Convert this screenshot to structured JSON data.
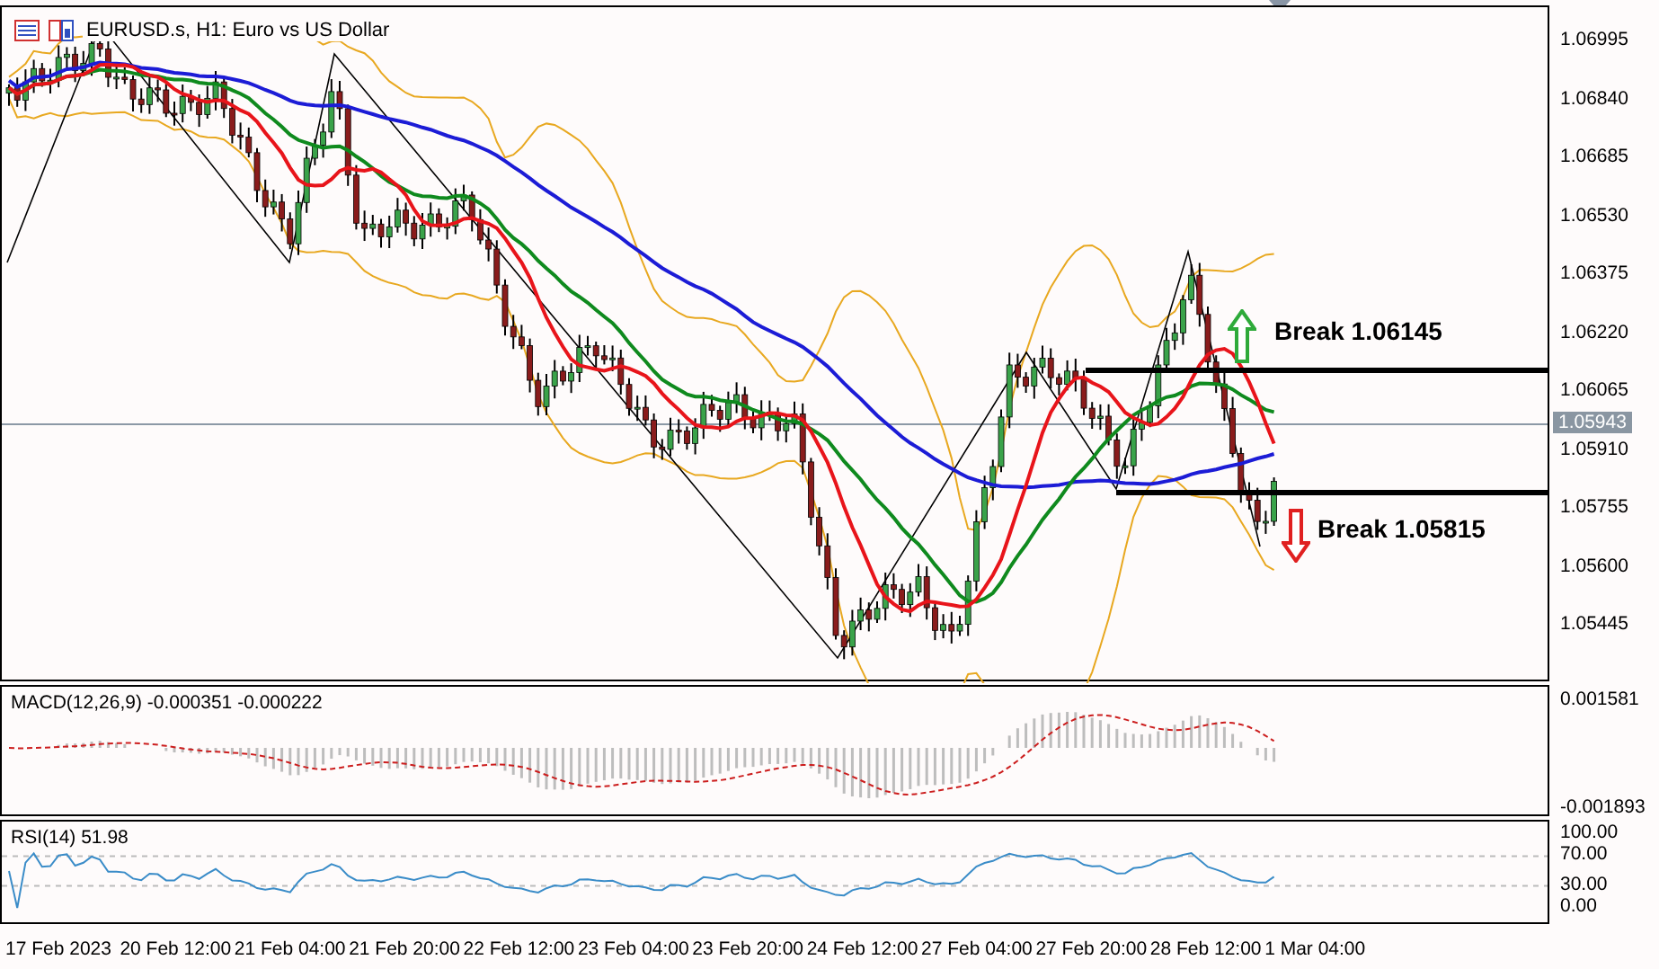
{
  "chart": {
    "title": "EURUSD.s, H1:  Euro vs US Dollar",
    "price_ticks": [
      "1.06995",
      "1.06840",
      "1.06685",
      "1.06530",
      "1.06375",
      "1.06220",
      "1.06065",
      "1.05910",
      "1.05755",
      "1.05600",
      "1.05445"
    ],
    "current_price": "1.05943",
    "annotations": [
      {
        "kind": "up",
        "label": "Break 1.06145"
      },
      {
        "kind": "down",
        "label": "Break 1.05815"
      }
    ]
  },
  "macd": {
    "label": "MACD(12,26,9) -0.000351 -0.000222",
    "ticks": [
      "0.001581",
      "-0.001893"
    ]
  },
  "rsi": {
    "label": "RSI(14) 51.98",
    "ticks": [
      "100.00",
      "70.00",
      "30.00",
      "0.00"
    ]
  },
  "time_axis": [
    "17 Feb 2023",
    "20 Feb 12:00",
    "21 Feb 04:00",
    "21 Feb 20:00",
    "22 Feb 12:00",
    "23 Feb 04:00",
    "23 Feb 20:00",
    "24 Feb 12:00",
    "27 Feb 04:00",
    "27 Feb 20:00",
    "28 Feb 12:00",
    "1 Mar 04:00"
  ]
}
